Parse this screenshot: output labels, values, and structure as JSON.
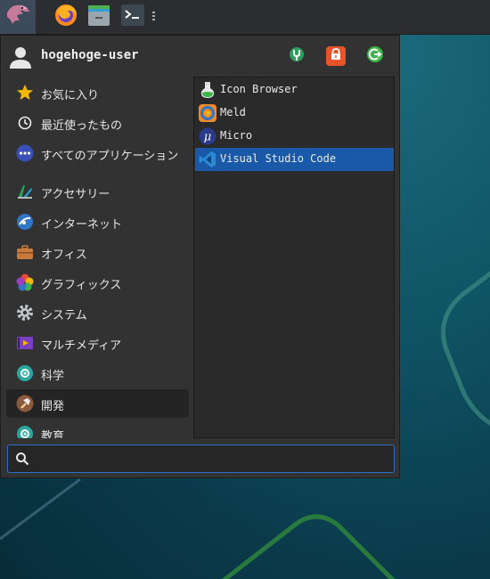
{
  "panel": {
    "launchers": [
      {
        "name": "firefox",
        "icon": "firefox-icon"
      },
      {
        "name": "file-manager",
        "icon": "file-manager-icon"
      },
      {
        "name": "terminal",
        "icon": "terminal-icon"
      }
    ]
  },
  "menu": {
    "user": {
      "name": "hogehoge-user"
    },
    "actions": [
      {
        "id": "settings",
        "icon": "settings-icon",
        "color": "#2aa05a"
      },
      {
        "id": "lock",
        "icon": "lock-icon",
        "color": "#e8532a"
      },
      {
        "id": "logout",
        "icon": "logout-icon",
        "color": "#3cb44a"
      }
    ],
    "categories": [
      {
        "label": "お気に入り",
        "icon": "star-icon"
      },
      {
        "label": "最近使ったもの",
        "icon": "clock-icon"
      },
      {
        "label": "すべてのアプリケーション",
        "icon": "more-icon"
      },
      {
        "label": "アクセサリー",
        "icon": "accessories-icon"
      },
      {
        "label": "インターネット",
        "icon": "internet-icon"
      },
      {
        "label": "オフィス",
        "icon": "office-icon"
      },
      {
        "label": "グラフィックス",
        "icon": "graphics-icon"
      },
      {
        "label": "システム",
        "icon": "system-icon"
      },
      {
        "label": "マルチメディア",
        "icon": "multimedia-icon"
      },
      {
        "label": "科学",
        "icon": "science-icon"
      },
      {
        "label": "開発",
        "icon": "development-icon",
        "active": true
      },
      {
        "label": "教育",
        "icon": "education-icon"
      }
    ],
    "apps": [
      {
        "label": "Icon Browser",
        "icon": "icon-browser-icon"
      },
      {
        "label": "Meld",
        "icon": "meld-icon"
      },
      {
        "label": "Micro",
        "icon": "micro-icon"
      },
      {
        "label": "Visual Studio Code",
        "icon": "vscode-icon",
        "selected": true
      }
    ],
    "search": {
      "placeholder": "",
      "value": ""
    }
  },
  "colors": {
    "accent": "#1a59a8",
    "search_border": "#2d6fc0",
    "menu_bg": "#323232"
  }
}
